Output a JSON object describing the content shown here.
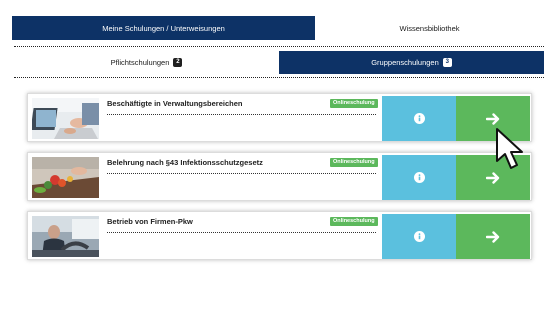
{
  "top_tabs": [
    {
      "label": "Meine Schulungen / Unterweisungen",
      "active": true
    },
    {
      "label": "Wissensbibliothek",
      "active": false
    }
  ],
  "sub_tabs": [
    {
      "label": "Pflichtschulungen",
      "count": "2",
      "active": false
    },
    {
      "label": "Gruppenschulungen",
      "count": "3",
      "active": true
    }
  ],
  "courses": [
    {
      "title": "Beschäftigte in Verwaltungsbereichen",
      "mode": "Onlineschulung",
      "image": "office-laptop-photo"
    },
    {
      "title": "Belehrung nach §43 Infektionsschutzgesetz",
      "mode": "Onlineschulung",
      "image": "kitchen-vegetables-photo"
    },
    {
      "title": "Betrieb von Firmen-Pkw",
      "mode": "Onlineschulung",
      "image": "car-driver-photo"
    }
  ],
  "icons": {
    "info": "info-icon",
    "go": "arrow-right-icon",
    "pointer": "mouse-pointer-icon"
  },
  "colors": {
    "primary": "#0d3266",
    "info": "#5bc0de",
    "success": "#5cb85c"
  }
}
